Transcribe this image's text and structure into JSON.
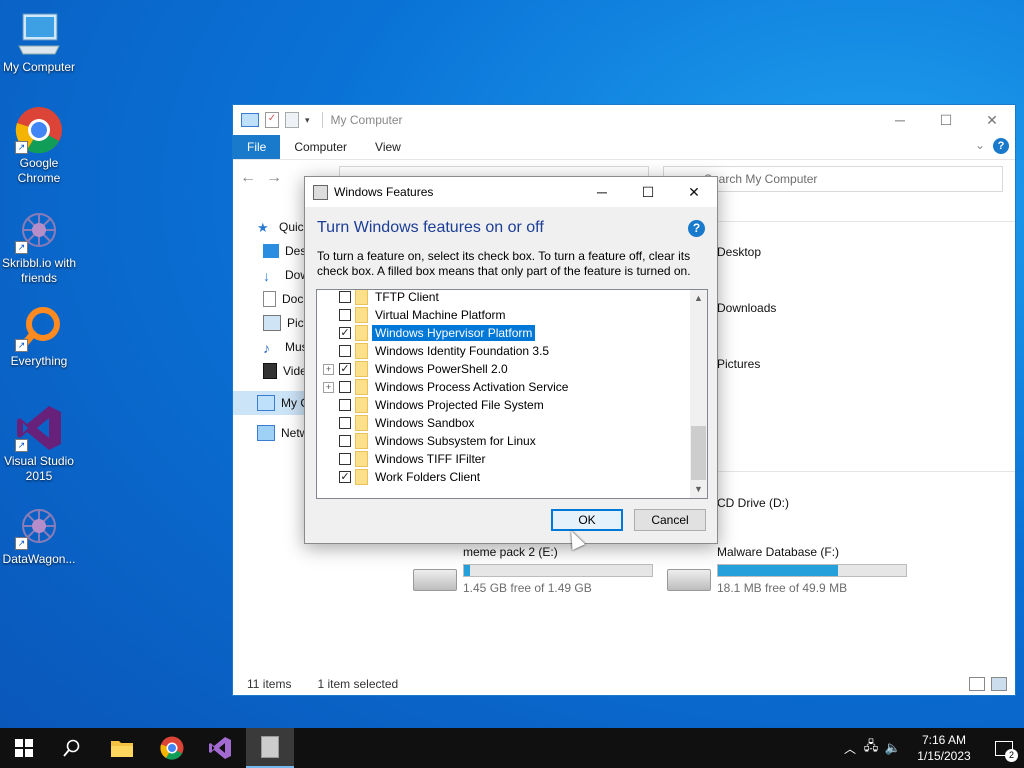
{
  "desktop": {
    "icons": [
      {
        "label": "My Computer",
        "icon": "my-computer-icon"
      },
      {
        "label": "Google Chrome",
        "icon": "chrome-icon"
      },
      {
        "label": "Skribbl.io with friends",
        "icon": "skribbl-icon"
      },
      {
        "label": "Everything",
        "icon": "everything-search-icon"
      },
      {
        "label": "Visual Studio 2015",
        "icon": "visual-studio-icon"
      },
      {
        "label": "DataWagon...",
        "icon": "datawagon-icon"
      }
    ]
  },
  "explorer": {
    "title": "My Computer",
    "ribbon": {
      "file": "File",
      "computer": "Computer",
      "view": "View"
    },
    "search_placeholder": "Search My Computer",
    "nav": [
      {
        "label": "Quick access"
      },
      {
        "label": "Desktop"
      },
      {
        "label": "Downloads"
      },
      {
        "label": "Documents"
      },
      {
        "label": "Pictures"
      },
      {
        "label": "Music"
      },
      {
        "label": "Videos"
      },
      {
        "label": "My Computer"
      },
      {
        "label": "Network"
      }
    ],
    "folders": {
      "desktop": "Desktop",
      "downloads": "Downloads",
      "pictures": "Pictures"
    },
    "cd_drive": "CD Drive (D:)",
    "drives": [
      {
        "name": "meme pack 2 (E:)",
        "free": "1.45 GB free of 1.49 GB",
        "used_fraction": 0.03
      },
      {
        "name": "Malware Database (F:)",
        "free": "18.1 MB free of 49.9 MB",
        "used_fraction": 0.64
      }
    ],
    "status": {
      "items": "11 items",
      "selected": "1 item selected"
    }
  },
  "dialog": {
    "title": "Windows Features",
    "heading": "Turn Windows features on or off",
    "description": "To turn a feature on, select its check box. To turn a feature off, clear its check box. A filled box means that only part of the feature is turned on.",
    "features": [
      {
        "label": "TFTP Client",
        "checked": false,
        "expandable": false
      },
      {
        "label": "Virtual Machine Platform",
        "checked": false,
        "expandable": false
      },
      {
        "label": "Windows Hypervisor Platform",
        "checked": true,
        "expandable": false,
        "selected": true
      },
      {
        "label": "Windows Identity Foundation 3.5",
        "checked": false,
        "expandable": false
      },
      {
        "label": "Windows PowerShell 2.0",
        "checked": true,
        "expandable": true
      },
      {
        "label": "Windows Process Activation Service",
        "checked": false,
        "expandable": true
      },
      {
        "label": "Windows Projected File System",
        "checked": false,
        "expandable": false
      },
      {
        "label": "Windows Sandbox",
        "checked": false,
        "expandable": false
      },
      {
        "label": "Windows Subsystem for Linux",
        "checked": false,
        "expandable": false
      },
      {
        "label": "Windows TIFF IFilter",
        "checked": false,
        "expandable": false
      },
      {
        "label": "Work Folders Client",
        "checked": true,
        "expandable": false
      }
    ],
    "ok": "OK",
    "cancel": "Cancel"
  },
  "taskbar": {
    "time": "7:16 AM",
    "date": "1/15/2023",
    "notifications": "2"
  },
  "colors": {
    "accent": "#0078d7",
    "desktop": "#0a72d6",
    "taskbar": "#101010"
  }
}
